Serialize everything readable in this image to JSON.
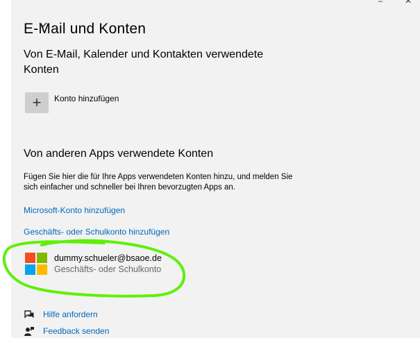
{
  "page": {
    "title": "E-Mail und Konten",
    "section1_heading": "Von E-Mail, Kalender und Kontakten verwendete\nKonten",
    "add_account_label": "Konto hinzufügen",
    "section2_heading": "Von anderen Apps verwendete Konten",
    "section2_description": "Fügen Sie hier die für Ihre Apps verwendeten Konten hinzu, und melden Sie sich einfacher und schneller bei Ihren bevorzugten Apps an.",
    "link_ms_account": "Microsoft-Konto hinzufügen",
    "link_work_account": "Geschäfts- oder Schulkonto hinzufügen"
  },
  "account": {
    "email": "dummy.schueler@bsaoe.de",
    "type": "Geschäfts- oder Schulkonto",
    "logo_colors": [
      "#f25022",
      "#7fba00",
      "#00a4ef",
      "#ffb900"
    ]
  },
  "footer": {
    "help_label": "Hilfe anfordern",
    "feedback_label": "Feedback senden"
  },
  "caption_controls": {
    "minimize": "–",
    "close": "✕"
  },
  "annotation": {
    "marker_color": "#5ef00a"
  }
}
